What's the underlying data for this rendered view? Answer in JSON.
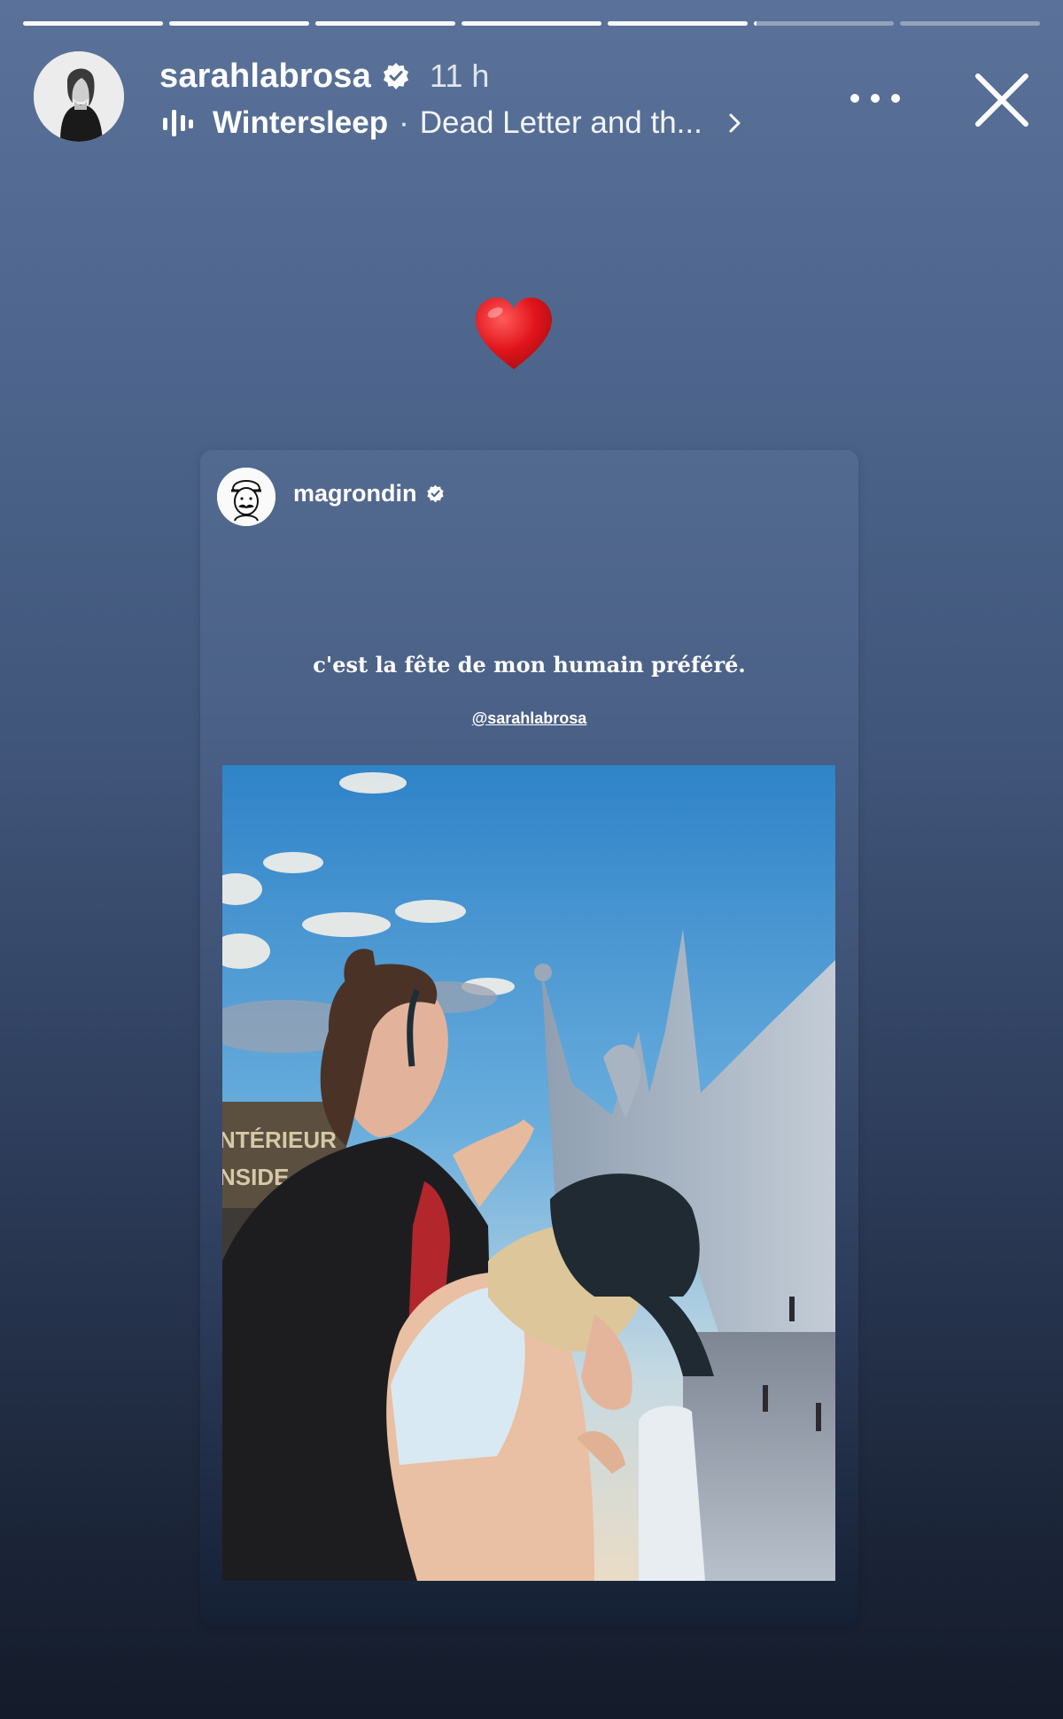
{
  "story": {
    "progress": [
      1,
      1,
      1,
      1,
      1,
      0.02,
      0
    ],
    "user": {
      "username": "sarahlabrosa",
      "verified": true,
      "time": "11 h"
    },
    "music": {
      "artist": "Wintersleep",
      "separator": "·",
      "song": "Dead Letter and th..."
    },
    "icons": {
      "verified": "verified-badge-icon",
      "music": "music-bars-icon",
      "chevron": "chevron-right-icon",
      "more": "more-dots-icon",
      "close": "close-icon",
      "heart": "red-heart-emoji"
    }
  },
  "reshare": {
    "username": "magrondin",
    "verified": true,
    "caption": "c'est la fête de mon humain préféré.",
    "mention": "@sarahlabrosa",
    "photo_sign_text": [
      "NTÉRIEUR",
      "NSIDE"
    ]
  },
  "colors": {
    "accent_heart": "#e0141b",
    "background_top": "#5a7299",
    "background_bottom": "#141b2a"
  }
}
